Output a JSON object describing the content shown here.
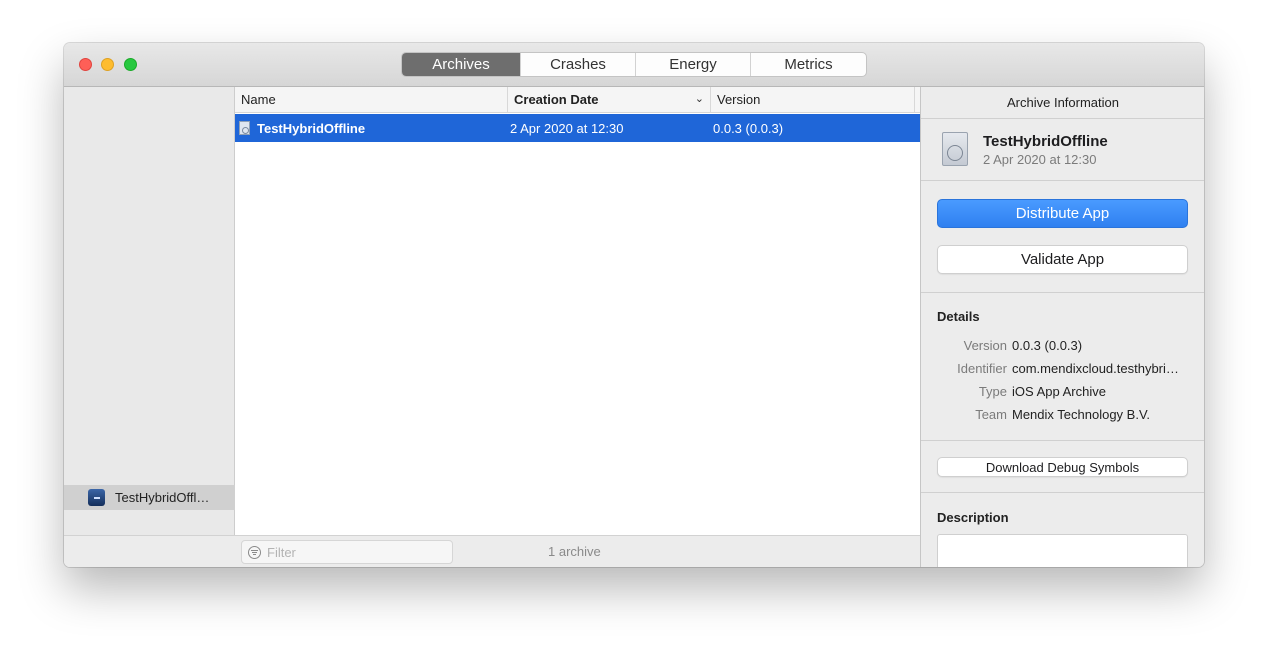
{
  "toolbar": {
    "tabs": [
      {
        "label": "Archives",
        "active": true
      },
      {
        "label": "Crashes",
        "active": false
      },
      {
        "label": "Energy",
        "active": false
      },
      {
        "label": "Metrics",
        "active": false
      }
    ]
  },
  "sidebar": {
    "items": [
      {
        "label": "TestHybridOffl…",
        "icon": "app-icon",
        "selected": true
      }
    ]
  },
  "table": {
    "columns": [
      "Name",
      "Creation Date",
      "Version"
    ],
    "sorted_column": "Creation Date",
    "rows": [
      {
        "name": "TestHybridOffline",
        "date": "2 Apr 2020 at 12:30",
        "version": "0.0.3 (0.0.3)",
        "selected": true
      }
    ]
  },
  "footer": {
    "filter_placeholder": "Filter",
    "count": "1 archive"
  },
  "inspector": {
    "title": "Archive Information",
    "archive_name": "TestHybridOffline",
    "archive_date": "2 Apr 2020 at 12:30",
    "distribute_label": "Distribute App",
    "validate_label": "Validate App",
    "details_heading": "Details",
    "details": [
      {
        "key": "Version",
        "value": "0.0.3 (0.0.3)"
      },
      {
        "key": "Identifier",
        "value": "com.mendixcloud.testhybri…"
      },
      {
        "key": "Type",
        "value": "iOS App Archive"
      },
      {
        "key": "Team",
        "value": "Mendix Technology B.V."
      }
    ],
    "debug_symbols_label": "Download Debug Symbols",
    "description_heading": "Description"
  },
  "colors": {
    "selection": "#1f66d8",
    "primary_button": "#3a8cf8",
    "active_tab": "#6e6e6e"
  }
}
